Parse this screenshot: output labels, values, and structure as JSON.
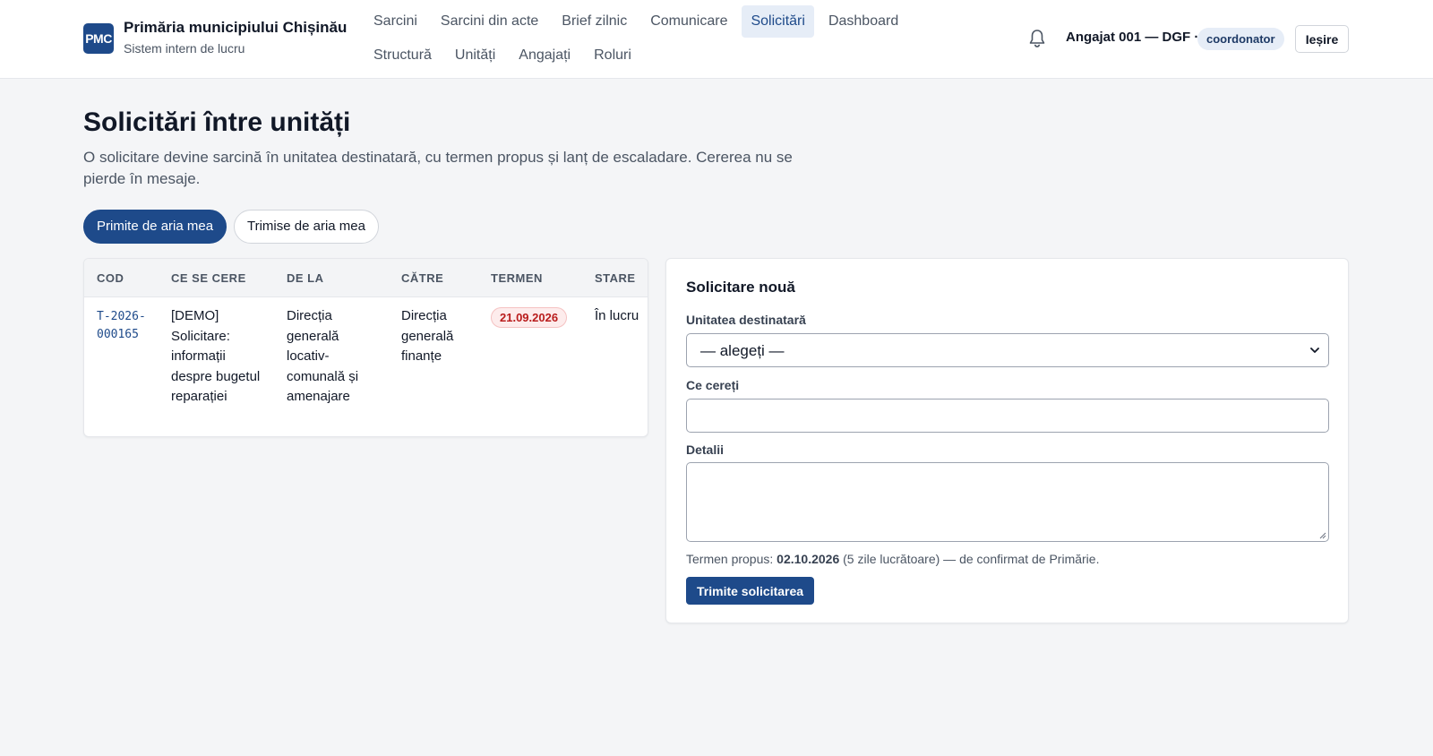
{
  "header": {
    "logo_text": "PMC",
    "org_name": "Primăria municipiului Chișinău",
    "org_subtitle": "Sistem intern de lucru",
    "nav_row1": [
      "Sarcini",
      "Sarcini din acte",
      "Brief zilnic",
      "Comunicare",
      "Solicitări",
      "Dashboard"
    ],
    "nav_row2": [
      "Structură",
      "Unități",
      "Angajați",
      "Roluri"
    ],
    "active_nav": "Solicitări",
    "user": "Angajat 001 — DGF ·",
    "role": "coordonator",
    "logout_label": "Ieșire"
  },
  "page": {
    "title": "Solicitări între unități",
    "description": "O solicitare devine sarcină în unitatea destinatară, cu termen propus și lanț de escaladare. Cererea nu se pierde în mesaje."
  },
  "tabs": [
    {
      "label": "Primite de aria mea",
      "active": true
    },
    {
      "label": "Trimise de aria mea",
      "active": false
    }
  ],
  "table": {
    "headers": [
      "COD",
      "CE SE CERE",
      "DE LA",
      "CĂTRE",
      "TERMEN",
      "STARE"
    ],
    "rows": [
      {
        "code": "T-2026-000165",
        "request": "[DEMO] Solicitare: informații despre bugetul reparației",
        "from": "Direcția generală locativ-comunală și amenajare",
        "to": "Direcția generală finanțe",
        "deadline": "21.09.2026",
        "status": "În lucru"
      }
    ]
  },
  "form": {
    "title": "Solicitare nouă",
    "unit_label": "Unitatea destinatară",
    "unit_value": "— alegeți —",
    "ask_label": "Ce cereți",
    "ask_value": "",
    "details_label": "Detalii",
    "details_value": "",
    "hint_prefix": "Termen propus:",
    "hint_date": "02.10.2026",
    "hint_suffix": "(5 zile lucrătoare) — de confirmat de Primărie.",
    "submit_label": "Trimite solicitarea"
  },
  "colors": {
    "brand": "#1e4a8a",
    "deadline_badge": "#b91c1c"
  }
}
